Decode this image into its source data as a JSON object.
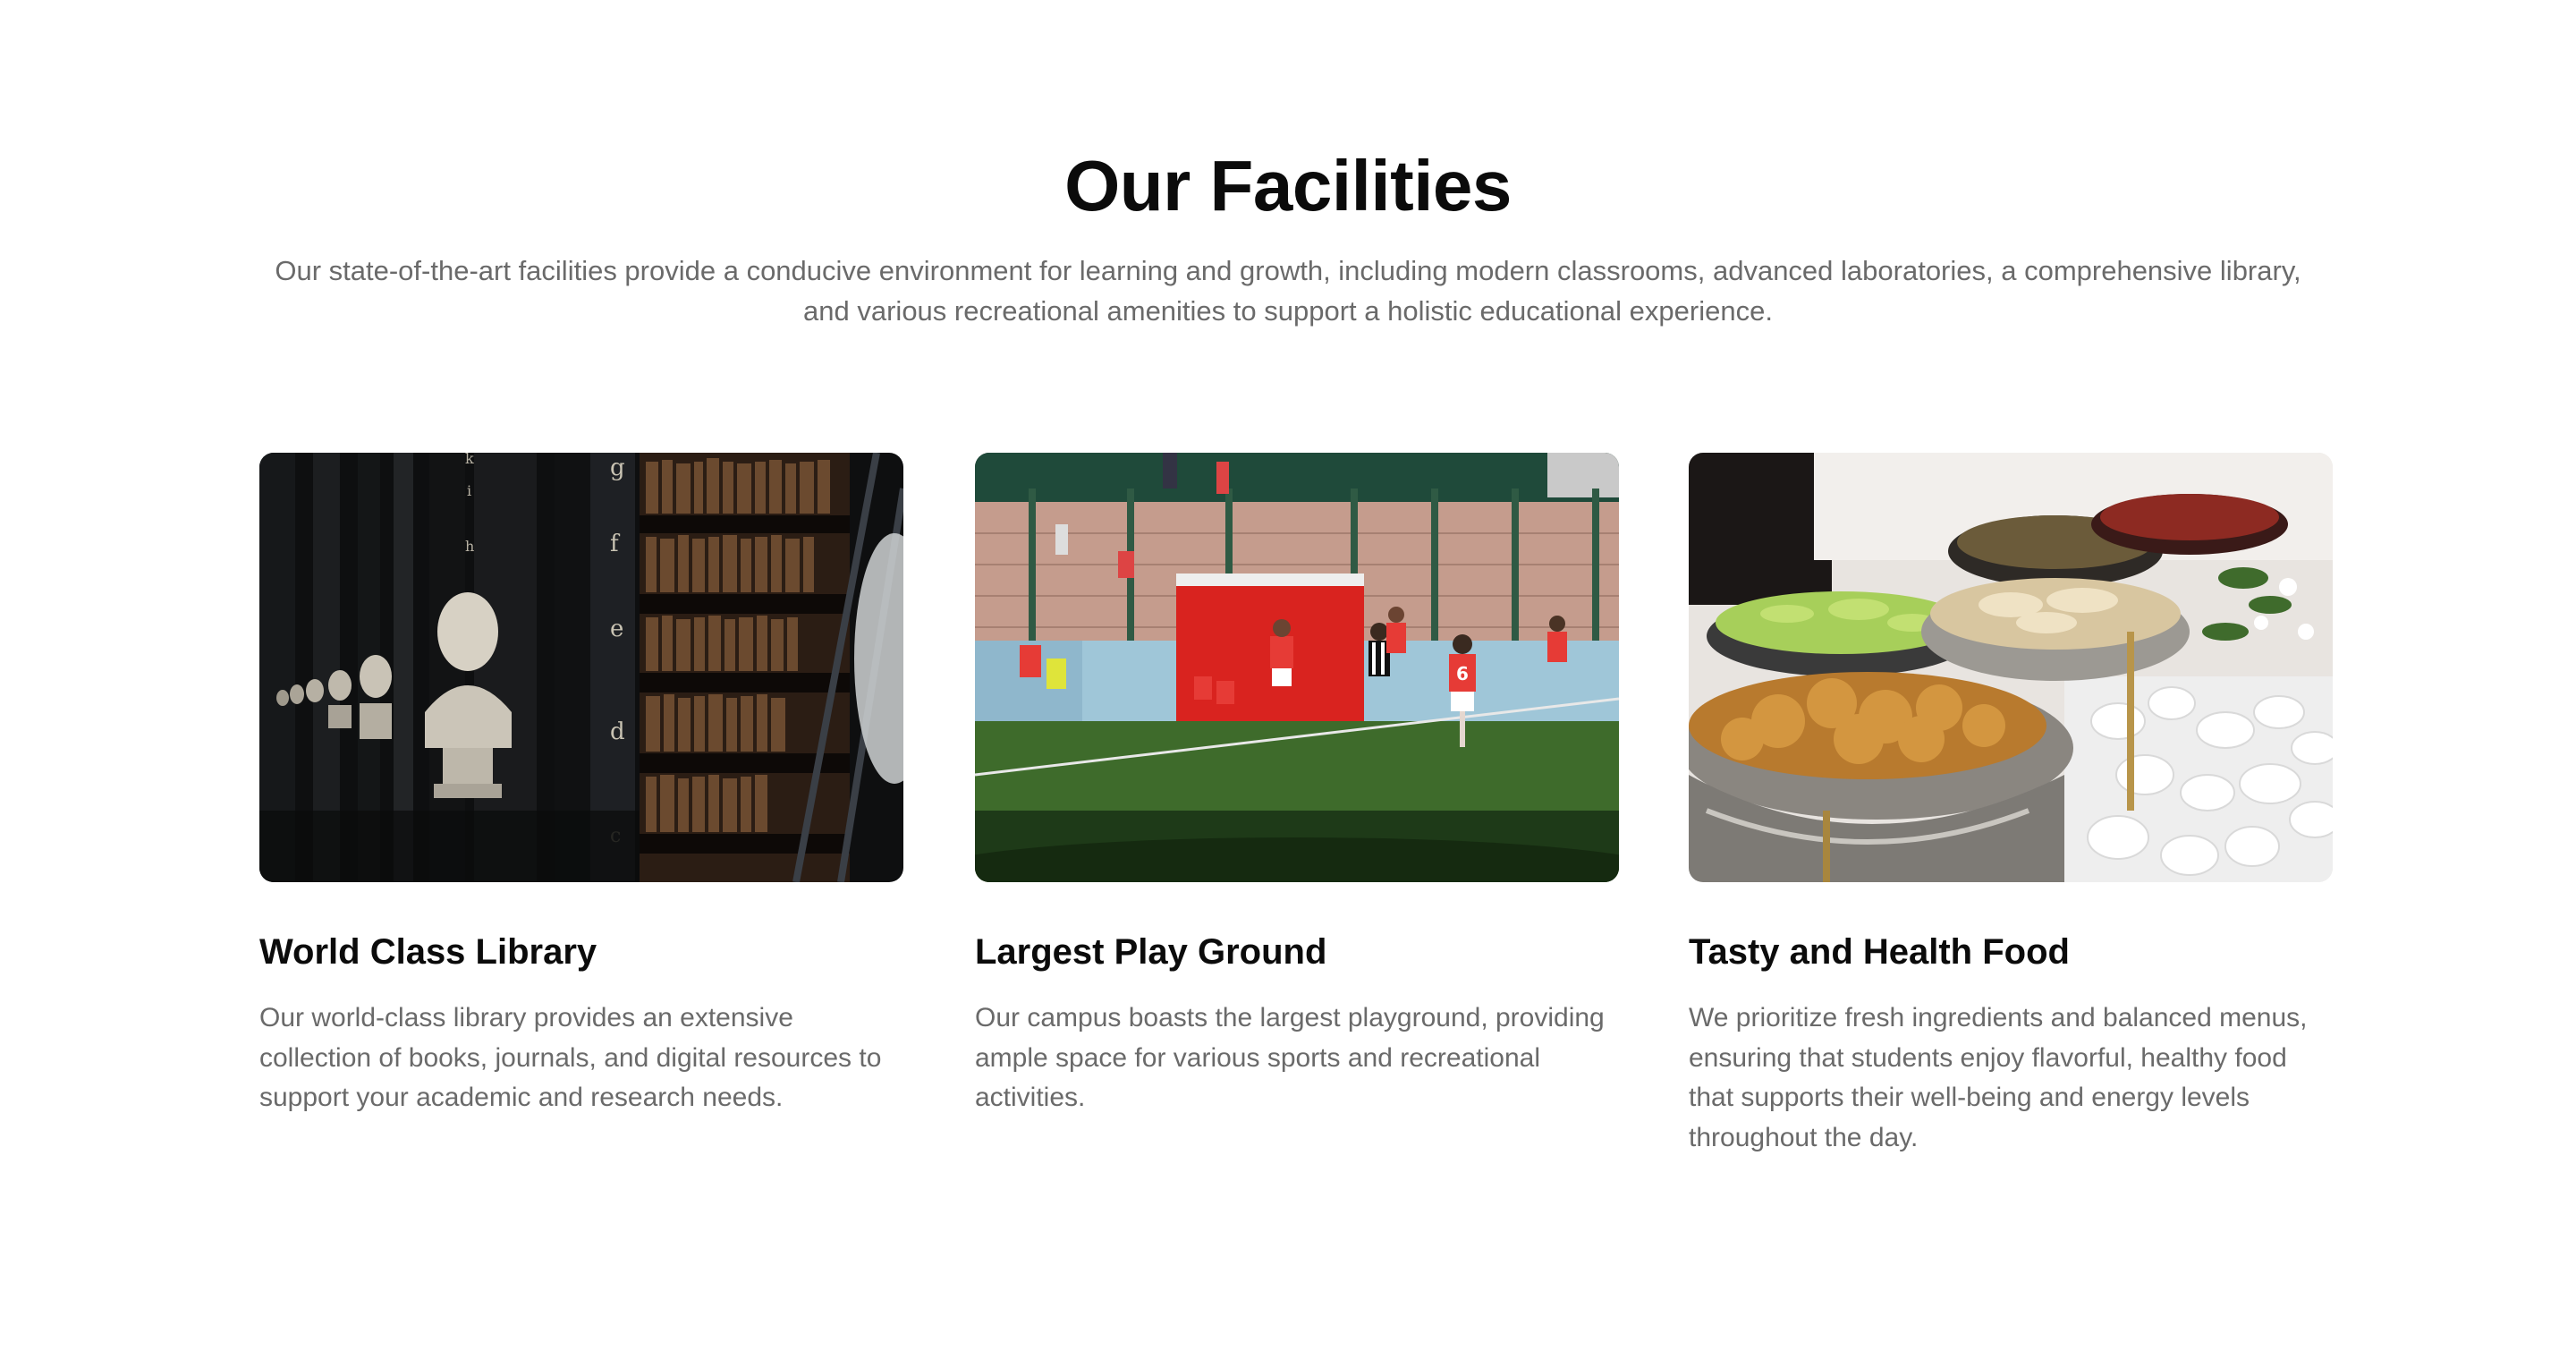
{
  "section": {
    "title": "Our Facilities",
    "intro": "Our state-of-the-art facilities provide a conducive environment for learning and growth, including modern classrooms, advanced laboratories, a comprehensive library, and various recreational amenities to support a holistic educational experience."
  },
  "facilities": [
    {
      "title": "World Class Library",
      "description": "Our world-class library provides an extensive collection of books, journals, and digital resources to support your academic and research needs.",
      "image": "library-photo"
    },
    {
      "title": "Largest Play Ground",
      "description": "Our campus boasts the largest playground, providing ample space for various sports and recreational activities.",
      "image": "playground-photo"
    },
    {
      "title": "Tasty and Health Food",
      "description": "We prioritize fresh ingredients and balanced menus, ensuring that students enjoy flavorful, healthy food that supports their well-being and energy levels throughout the day.",
      "image": "food-photo"
    }
  ],
  "colors": {
    "heading": "#0b0b0b",
    "body_text": "#6a6a6a",
    "background": "#ffffff"
  }
}
